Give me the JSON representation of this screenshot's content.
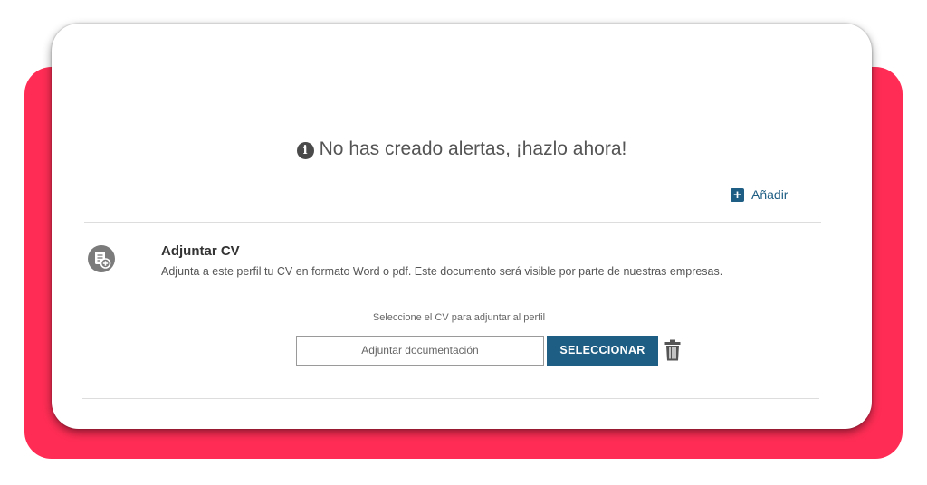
{
  "colors": {
    "backdrop": "#ff2d55",
    "accent": "#1e5e84",
    "text": "#555555"
  },
  "alerts": {
    "info_icon": "info-circle-icon",
    "info_glyph": "i",
    "message": "No has creado alertas, ¡hazlo ahora!",
    "add_icon": "plus-square-icon",
    "add_glyph": "+",
    "add_label": "Añadir"
  },
  "cv_section": {
    "icon": "document-add-icon",
    "title": "Adjuntar CV",
    "description": "Adjunta a este perfil tu CV en formato Word o pdf. Este documento será visible por parte de nuestras empresas.",
    "hint": "Seleccione el CV para adjuntar al perfil",
    "file_input_placeholder": "Adjuntar documentación",
    "select_button_label": "SELECCIONAR",
    "delete_icon": "trash-icon"
  }
}
